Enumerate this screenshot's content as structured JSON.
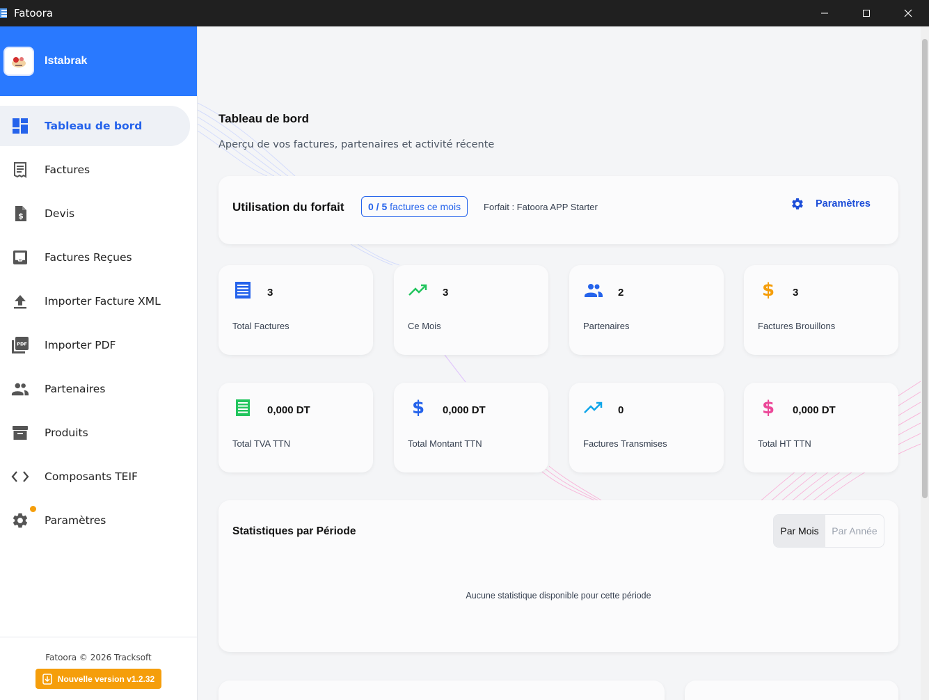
{
  "window": {
    "title": "Fatoora",
    "controls": {
      "minimize": "minimize-icon",
      "maximize": "maximize-icon",
      "close": "close-icon"
    }
  },
  "sidebar": {
    "company_name": "Istabrak",
    "items": [
      {
        "label": "Tableau de bord",
        "icon": "dashboard-icon",
        "active": true
      },
      {
        "label": "Factures",
        "icon": "receipt-icon"
      },
      {
        "label": "Devis",
        "icon": "quote-document-icon"
      },
      {
        "label": "Factures Reçues",
        "icon": "inbox-icon"
      },
      {
        "label": "Importer Facture XML",
        "icon": "upload-icon"
      },
      {
        "label": "Importer PDF",
        "icon": "pdf-icon"
      },
      {
        "label": "Partenaires",
        "icon": "people-icon"
      },
      {
        "label": "Produits",
        "icon": "archive-box-icon"
      },
      {
        "label": "Composants TEIF",
        "icon": "code-icon"
      },
      {
        "label": "Paramètres",
        "icon": "gear-icon",
        "has_notification": true
      }
    ],
    "footer": {
      "copyright": "Fatoora © 2026 Tracksoft",
      "update_label": "Nouvelle version v1.2.32"
    }
  },
  "main": {
    "title": "Tableau de bord",
    "subtitle": "Aperçu de vos factures, partenaires et activité récente",
    "plan": {
      "title": "Utilisation du forfait",
      "usage_count": "0 / 5",
      "usage_text": "factures ce mois",
      "plan_name": "Forfait : Fatoora APP Starter",
      "settings_label": "Paramètres"
    },
    "stats": [
      {
        "value": "3",
        "label": "Total Factures",
        "icon": "list-document-icon",
        "color": "#2563eb"
      },
      {
        "value": "3",
        "label": "Ce Mois",
        "icon": "trending-up-icon",
        "color": "#22c55e"
      },
      {
        "value": "2",
        "label": "Partenaires",
        "icon": "people-icon",
        "color": "#2563eb"
      },
      {
        "value": "3",
        "label": "Factures Brouillons",
        "icon": "dollar-icon",
        "color": "#f59e0b"
      },
      {
        "value": "0,000 DT",
        "label": "Total TVA TTN",
        "icon": "receipt-icon",
        "color": "#22c55e"
      },
      {
        "value": "0,000 DT",
        "label": "Total Montant TTN",
        "icon": "dollar-icon",
        "color": "#2563eb"
      },
      {
        "value": "0",
        "label": "Factures Transmises",
        "icon": "trending-up-icon",
        "color": "#0ea5e9"
      },
      {
        "value": "0,000 DT",
        "label": "Total HT TTN",
        "icon": "dollar-icon",
        "color": "#ec4899"
      }
    ],
    "period": {
      "title": "Statistiques par Période",
      "options": [
        "Par Mois",
        "Par Année"
      ],
      "selected": "Par Mois",
      "empty_message": "Aucune statistique disponible pour cette période"
    }
  },
  "colors": {
    "accent": "#2979ff",
    "active_nav_text": "#2563eb",
    "notification": "#f59e0b",
    "update_button": "#f59e0b"
  }
}
